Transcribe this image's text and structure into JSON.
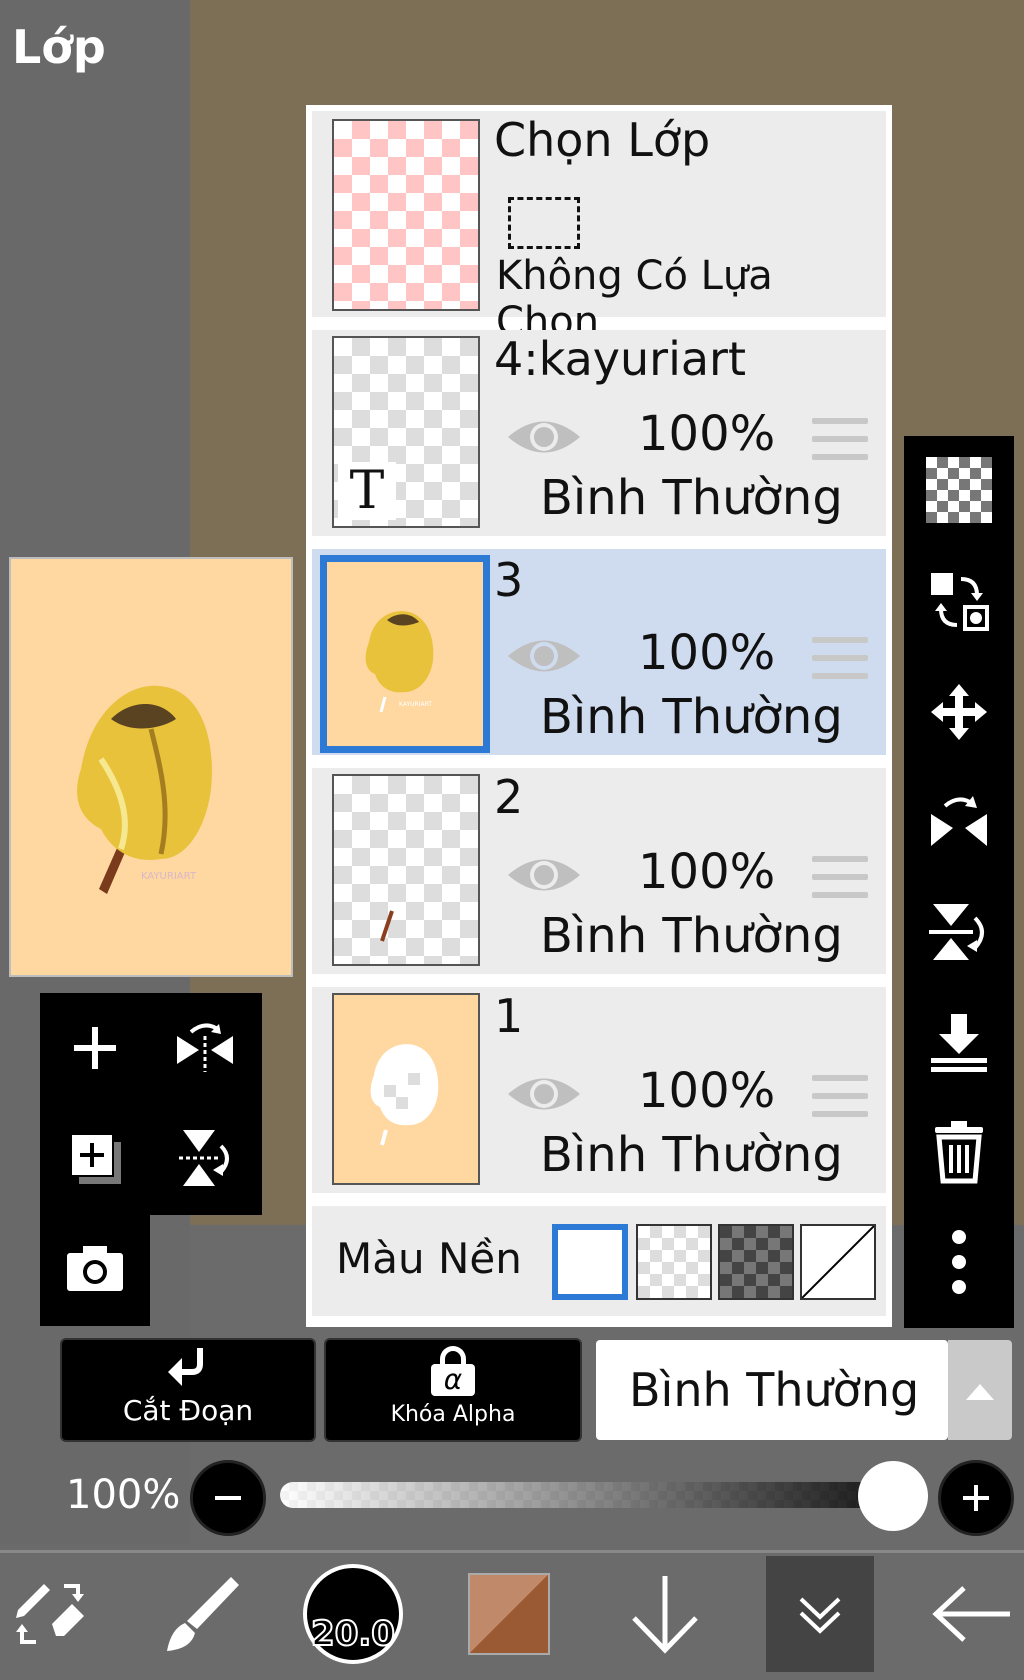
{
  "header": {
    "title": "Lớp"
  },
  "selection_row": {
    "title": "Chọn Lớp",
    "status": "Không Có Lựa Chọn"
  },
  "layers": [
    {
      "name": "4:kayuriart",
      "opacity": "100%",
      "blend": "Bình Thường",
      "selected": false,
      "type": "text",
      "thumb_glyph": "T"
    },
    {
      "name": "3",
      "opacity": "100%",
      "blend": "Bình Thường",
      "selected": true,
      "type": "image"
    },
    {
      "name": "2",
      "opacity": "100%",
      "blend": "Bình Thường",
      "selected": false,
      "type": "image"
    },
    {
      "name": "1",
      "opacity": "100%",
      "blend": "Bình Thường",
      "selected": false,
      "type": "image"
    }
  ],
  "background": {
    "label": "Màu Nền",
    "options": [
      "white",
      "checker-light",
      "checker-dark",
      "none"
    ],
    "selected": "white"
  },
  "controls": {
    "clip_label": "Cắt Đoạn",
    "alpha_lock_label": "Khóa Alpha",
    "alpha_glyph": "α",
    "blend_mode": "Bình Thường"
  },
  "opacity": {
    "label": "100%",
    "value": 1.0
  },
  "bottom_bar": {
    "brush_size": "20.0"
  },
  "colors": {
    "accent": "#2d7ad6",
    "selected_row": "#cfdcef",
    "canvas": "#ffd7a0",
    "brown": "#9a5a33"
  }
}
